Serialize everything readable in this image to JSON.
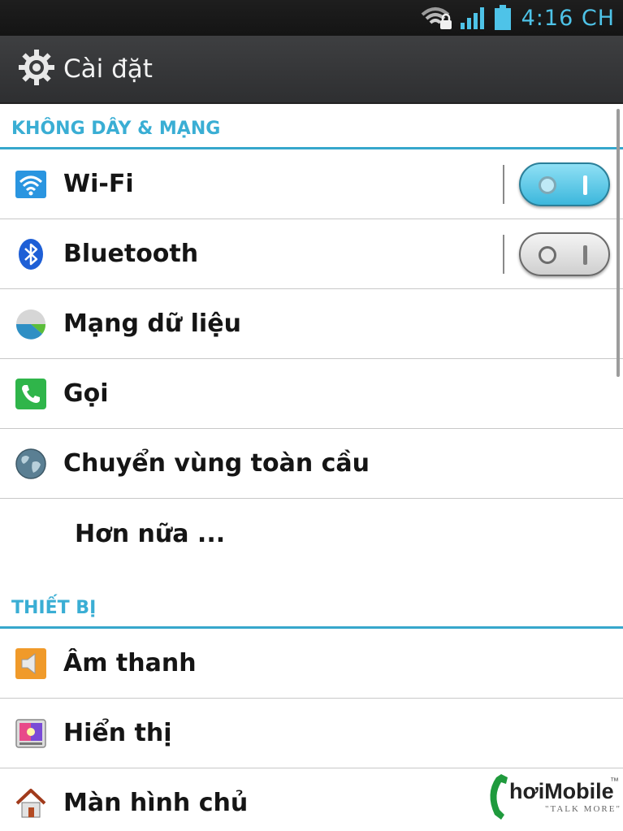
{
  "status_bar": {
    "time": "4:16 CH",
    "icons": [
      "wifi-lock-icon",
      "signal-icon",
      "battery-icon"
    ],
    "accent": "#4ec3e8"
  },
  "action_bar": {
    "title": "Cài đặt",
    "icon": "gear-icon"
  },
  "sections": {
    "wireless": {
      "header": "KHÔNG DÂY & MẠNG",
      "items": [
        {
          "label": "Wi-Fi",
          "icon": "wifi-icon",
          "toggle": "on"
        },
        {
          "label": "Bluetooth",
          "icon": "bluetooth-icon",
          "toggle": "off"
        },
        {
          "label": "Mạng dữ liệu",
          "icon": "data-usage-icon"
        },
        {
          "label": "Gọi",
          "icon": "phone-icon"
        },
        {
          "label": "Chuyển vùng toàn cầu",
          "icon": "globe-icon"
        },
        {
          "label": "Hơn nữa ..."
        }
      ]
    },
    "device": {
      "header": "THIẾT BỊ",
      "items": [
        {
          "label": "Âm thanh",
          "icon": "speaker-icon"
        },
        {
          "label": "Hiển thị",
          "icon": "display-icon"
        },
        {
          "label": "Màn hình chủ",
          "icon": "home-icon"
        }
      ]
    }
  },
  "watermark": {
    "brand": "hơiMobile",
    "tagline": "TALK MORE",
    "mark": "™"
  },
  "colors": {
    "section_header": "#3aaed4",
    "toggle_on": "#3cb7dc"
  }
}
